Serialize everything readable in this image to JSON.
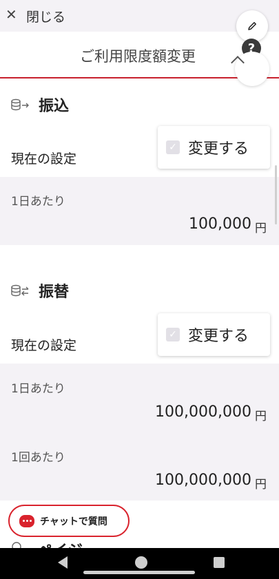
{
  "topbar": {
    "close_label": "閉じる",
    "close_icon": "close-icon"
  },
  "header": {
    "title": "ご利用限度額変更",
    "help_symbol": "?"
  },
  "sections": [
    {
      "title": "振込",
      "icon": "coins-arrow-icon",
      "setting_label": "現在の設定",
      "change_label": "変更する",
      "rows": [
        {
          "label": "1日あたり",
          "value": "100,000",
          "unit": "円"
        }
      ]
    },
    {
      "title": "振替",
      "icon": "coins-transfer-icon",
      "setting_label": "現在の設定",
      "change_label": "変更する",
      "rows": [
        {
          "label": "1日あたり",
          "value": "100,000,000",
          "unit": "円"
        },
        {
          "label": "1回あたり",
          "value": "100,000,000",
          "unit": "円"
        }
      ]
    },
    {
      "title": "ペイジー"
    }
  ],
  "chat": {
    "label": "チャットで質問"
  },
  "colors": {
    "accent": "#c8202c",
    "panel": "#f4f2f6"
  }
}
